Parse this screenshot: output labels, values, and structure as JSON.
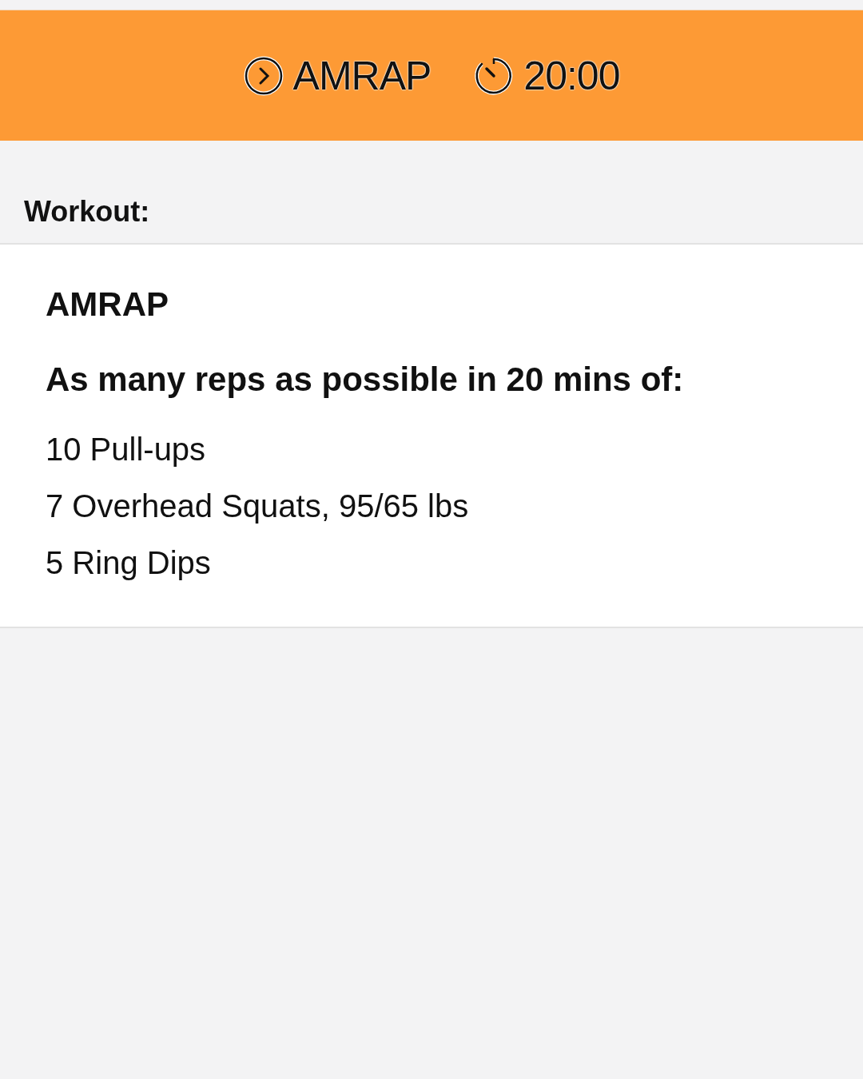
{
  "header": {
    "type": "AMRAP",
    "duration": "20:00"
  },
  "section_label": "Workout:",
  "workout": {
    "title": "AMRAP",
    "subtitle": "As many reps as possible in 20 mins of:",
    "movements": [
      "10 Pull-ups",
      "7 Overhead Squats, 95/65 lbs",
      "5 Ring Dips"
    ]
  }
}
